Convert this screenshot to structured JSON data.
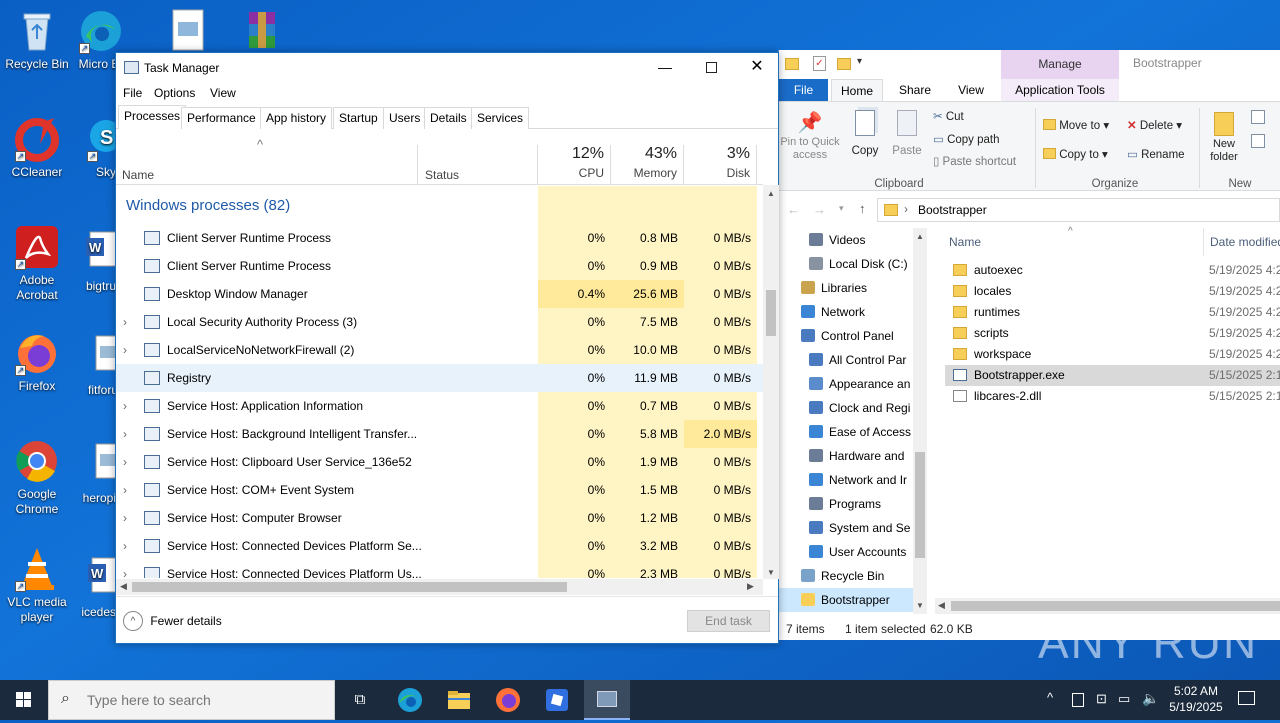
{
  "desktop": {
    "icons": [
      {
        "label": "Recycle Bin"
      },
      {
        "label": "Micro Ed"
      },
      {
        "label": "CCleaner"
      },
      {
        "label": "Sky"
      },
      {
        "label": "Adobe Acrobat"
      },
      {
        "label": "bigtru"
      },
      {
        "label": "Firefox"
      },
      {
        "label": "fitforu"
      },
      {
        "label": "Google Chrome"
      },
      {
        "label": "heropi"
      },
      {
        "label": "VLC media player"
      },
      {
        "label": "icedes"
      }
    ]
  },
  "task_manager": {
    "title": "Task Manager",
    "menu": [
      "File",
      "Options",
      "View"
    ],
    "tabs": [
      "Processes",
      "Performance",
      "App history",
      "Startup",
      "Users",
      "Details",
      "Services"
    ],
    "columns": {
      "name": "Name",
      "status": "Status",
      "cpu": {
        "pct": "12%",
        "label": "CPU"
      },
      "memory": {
        "pct": "43%",
        "label": "Memory"
      },
      "disk": {
        "pct": "3%",
        "label": "Disk"
      }
    },
    "group_header": "Windows processes (82)",
    "processes": [
      {
        "name": "Client Server Runtime Process",
        "cpu": "0%",
        "mem": "0.8 MB",
        "disk": "0 MB/s",
        "expand": false
      },
      {
        "name": "Client Server Runtime Process",
        "cpu": "0%",
        "mem": "0.9 MB",
        "disk": "0 MB/s",
        "expand": false
      },
      {
        "name": "Desktop Window Manager",
        "cpu": "0.4%",
        "mem": "25.6 MB",
        "disk": "0 MB/s",
        "expand": false
      },
      {
        "name": "Local Security Authority Process (3)",
        "cpu": "0%",
        "mem": "7.5 MB",
        "disk": "0 MB/s",
        "expand": true
      },
      {
        "name": "LocalServiceNoNetworkFirewall (2)",
        "cpu": "0%",
        "mem": "10.0 MB",
        "disk": "0 MB/s",
        "expand": true
      },
      {
        "name": "Registry",
        "cpu": "0%",
        "mem": "11.9 MB",
        "disk": "0 MB/s",
        "expand": false
      },
      {
        "name": "Service Host: Application Information",
        "cpu": "0%",
        "mem": "0.7 MB",
        "disk": "0 MB/s",
        "expand": true
      },
      {
        "name": "Service Host: Background Intelligent Transfer...",
        "cpu": "0%",
        "mem": "5.8 MB",
        "disk": "2.0 MB/s",
        "expand": true
      },
      {
        "name": "Service Host: Clipboard User Service_136e52",
        "cpu": "0%",
        "mem": "1.9 MB",
        "disk": "0 MB/s",
        "expand": true
      },
      {
        "name": "Service Host: COM+ Event System",
        "cpu": "0%",
        "mem": "1.5 MB",
        "disk": "0 MB/s",
        "expand": true
      },
      {
        "name": "Service Host: Computer Browser",
        "cpu": "0%",
        "mem": "1.2 MB",
        "disk": "0 MB/s",
        "expand": true
      },
      {
        "name": "Service Host: Connected Devices Platform Se...",
        "cpu": "0%",
        "mem": "3.2 MB",
        "disk": "0 MB/s",
        "expand": true
      },
      {
        "name": "Service Host: Connected Devices Platform Us...",
        "cpu": "0%",
        "mem": "2.3 MB",
        "disk": "0 MB/s",
        "expand": true
      }
    ],
    "fewer_details": "Fewer details",
    "end_task": "End task"
  },
  "explorer": {
    "title": "Bootstrapper",
    "manage_label": "Manage",
    "ribbon_tabs": [
      "File",
      "Home",
      "Share",
      "View",
      "Application Tools"
    ],
    "clipboard": {
      "pin": "Pin to Quick access",
      "copy": "Copy",
      "paste": "Paste",
      "cut": "Cut",
      "copy_path": "Copy path",
      "paste_shortcut": "Paste shortcut",
      "group": "Clipboard"
    },
    "organize": {
      "move_to": "Move to",
      "copy_to": "Copy to",
      "delete": "Delete",
      "rename": "Rename",
      "group": "Organize"
    },
    "new": {
      "new_folder": "New folder",
      "group": "New"
    },
    "address": "Bootstrapper",
    "nav": [
      "Videos",
      "Local Disk (C:)",
      "Libraries",
      "Network",
      "Control Panel",
      "All Control Par",
      "Appearance an",
      "Clock and Regi",
      "Ease of Access",
      "Hardware and",
      "Network and Ir",
      "Programs",
      "System and Se",
      "User Accounts",
      "Recycle Bin",
      "Bootstrapper"
    ],
    "columns": {
      "name": "Name",
      "date": "Date modified"
    },
    "files": [
      {
        "name": "autoexec",
        "date": "5/19/2025 4:2",
        "type": "folder"
      },
      {
        "name": "locales",
        "date": "5/19/2025 4:2",
        "type": "folder"
      },
      {
        "name": "runtimes",
        "date": "5/19/2025 4:2",
        "type": "folder"
      },
      {
        "name": "scripts",
        "date": "5/19/2025 4:2",
        "type": "folder"
      },
      {
        "name": "workspace",
        "date": "5/19/2025 4:2",
        "type": "folder"
      },
      {
        "name": "Bootstrapper.exe",
        "date": "5/15/2025 2:1",
        "type": "exe"
      },
      {
        "name": "libcares-2.dll",
        "date": "5/15/2025 2:1",
        "type": "dll"
      }
    ],
    "status": {
      "items": "7 items",
      "selected": "1 item selected",
      "size": "62.0 KB"
    }
  },
  "taskbar": {
    "search_placeholder": "Type here to search",
    "time": "5:02 AM",
    "date": "5/19/2025"
  },
  "watermark": "ANY RUN",
  "colors": {
    "accent": "#1a73d9",
    "cpu_light": "#fff4c4",
    "cpu_dark": "#ffe99a",
    "selected": "#dceaf7"
  }
}
